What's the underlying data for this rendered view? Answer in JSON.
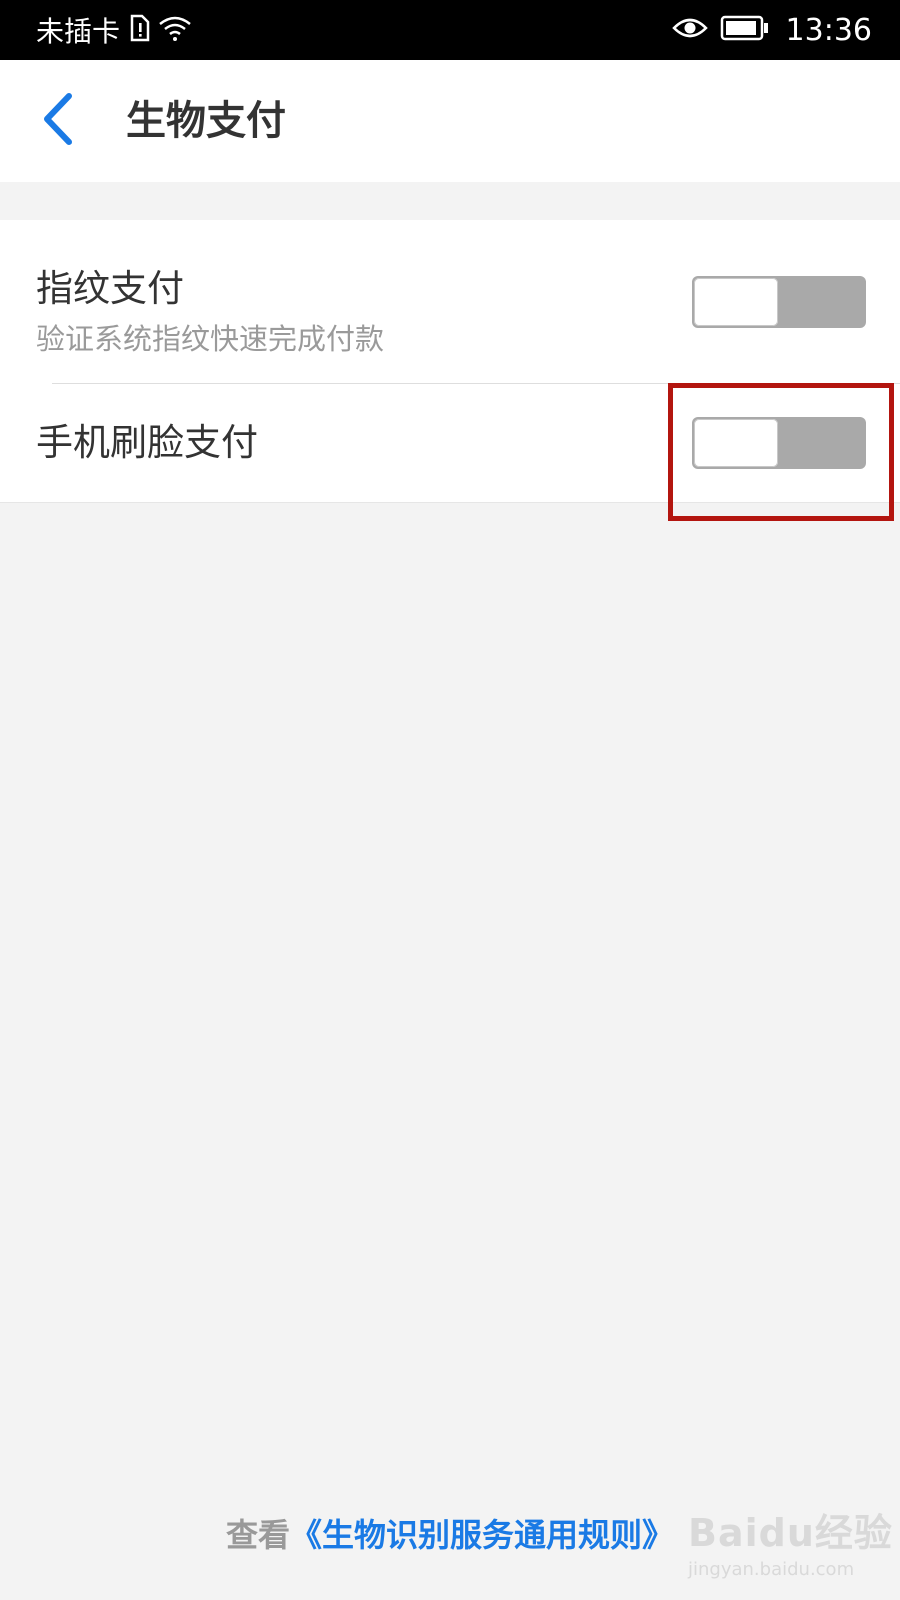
{
  "status_bar": {
    "carrier": "未插卡",
    "time": "13:36",
    "icons": [
      "sim-alert-icon",
      "wifi-icon",
      "eye-icon",
      "battery-icon"
    ]
  },
  "nav": {
    "back_icon": "chevron-left-icon",
    "title": "生物支付"
  },
  "settings": {
    "items": [
      {
        "title": "指纹支付",
        "subtitle": "验证系统指纹快速完成付款",
        "enabled": false
      },
      {
        "title": "手机刷脸支付",
        "enabled": false
      }
    ]
  },
  "footer": {
    "prefix": "查看",
    "link": "《生物识别服务通用规则》"
  },
  "watermark": {
    "logo": "Baidu经验",
    "url": "jingyan.baidu.com"
  },
  "colors": {
    "accent": "#1a7ae5",
    "highlight": "#b3150f",
    "toggle_off": "#a9a9a9"
  }
}
